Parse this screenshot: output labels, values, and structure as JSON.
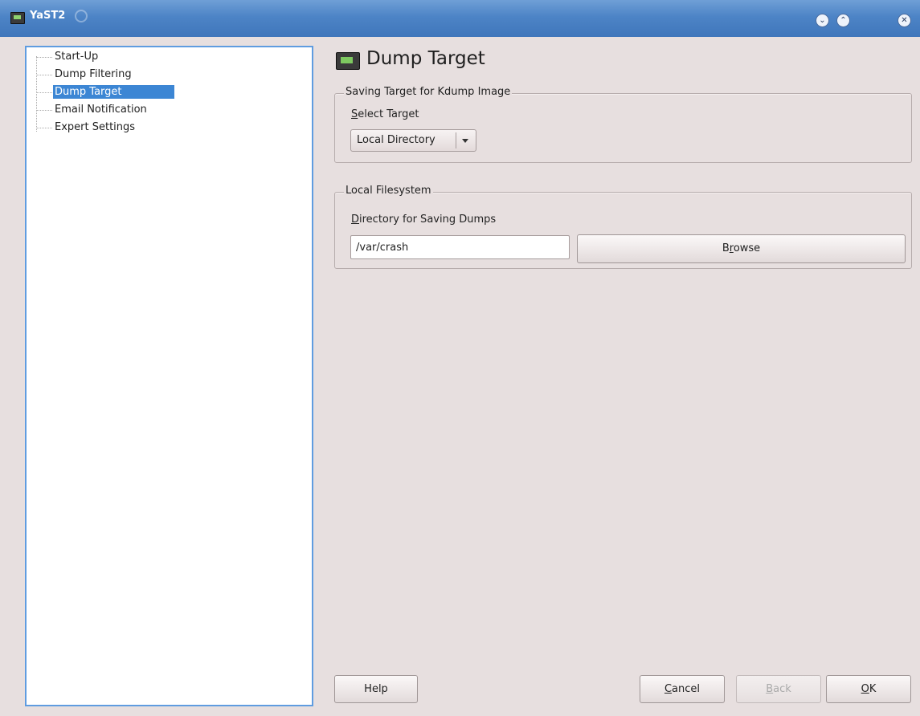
{
  "window": {
    "title": "YaST2"
  },
  "sidebar": {
    "items": [
      {
        "label": "Start-Up",
        "selected": false
      },
      {
        "label": "Dump Filtering",
        "selected": false
      },
      {
        "label": "Dump Target",
        "selected": true
      },
      {
        "label": "Email Notification",
        "selected": false
      },
      {
        "label": "Expert Settings",
        "selected": false
      }
    ]
  },
  "main": {
    "title": "Dump Target",
    "saving_group": {
      "title": "Saving Target for Kdump Image",
      "select_label_mnemonic": "S",
      "select_label_rest": "elect Target",
      "select_value": "Local Directory"
    },
    "filesystem_group": {
      "title": "Local Filesystem",
      "dir_label_mnemonic": "D",
      "dir_label_rest": "irectory for Saving Dumps",
      "dir_value": "/var/crash",
      "browse_pre": "B",
      "browse_mnemonic": "r",
      "browse_post": "owse"
    }
  },
  "footer": {
    "help_label": "Help",
    "cancel_mnemonic": "C",
    "cancel_rest": "ancel",
    "back_mnemonic": "B",
    "back_rest": "ack",
    "ok_mnemonic": "O",
    "ok_rest": "K"
  },
  "colors": {
    "titlebar": "#4d84c6",
    "selection": "#3c86d4",
    "background": "#e7dfdf"
  },
  "icons": [
    "yast-app-icon",
    "spiral-icon",
    "minimize-icon",
    "maximize-icon",
    "close-icon",
    "dump-target-icon",
    "dropdown-arrow-icon"
  ]
}
